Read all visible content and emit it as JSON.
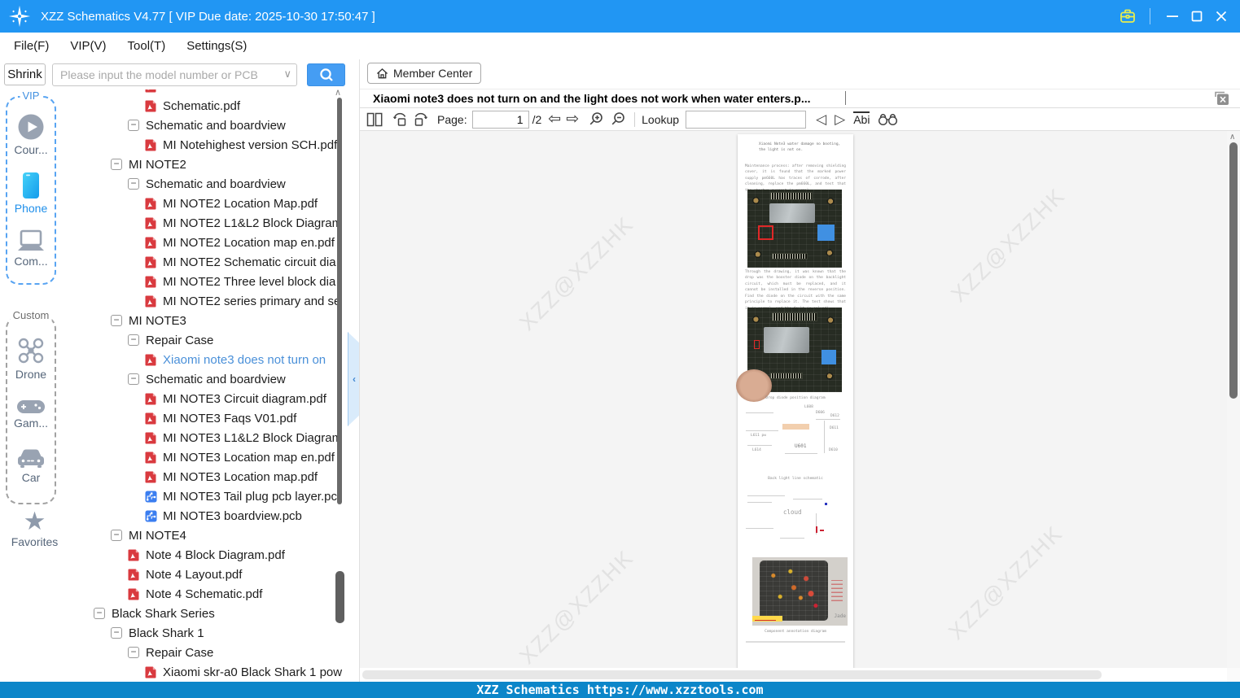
{
  "window": {
    "title": "XZZ Schematics V4.77 [ VIP Due date: 2025-10-30 17:50:47 ]"
  },
  "menu": {
    "items": [
      {
        "label": "File(F)"
      },
      {
        "label": "VIP(V)"
      },
      {
        "label": "Tool(T)"
      },
      {
        "label": "Settings(S)"
      }
    ]
  },
  "searchbar": {
    "shrink_label": "Shrink",
    "placeholder": "Please input the model number or PCB"
  },
  "member_center": {
    "label": "Member Center"
  },
  "sidebar": {
    "vip_label": "VIP",
    "custom_label": "Custom",
    "vip_items": [
      {
        "icon": "course-play-icon",
        "label": "Cour..."
      },
      {
        "icon": "phone-icon",
        "label": "Phone"
      },
      {
        "icon": "computer-icon",
        "label": "Com..."
      }
    ],
    "custom_items": [
      {
        "icon": "drone-icon",
        "label": "Drone"
      },
      {
        "icon": "gamepad-icon",
        "label": "Gam..."
      },
      {
        "icon": "car-icon",
        "label": "Car"
      }
    ],
    "favorites_label": "Favorites"
  },
  "tree": {
    "items": [
      {
        "level": 3,
        "icon": "pdf",
        "label": ""
      },
      {
        "level": 3,
        "icon": "pdf",
        "label": "Schematic.pdf"
      },
      {
        "level": 2,
        "icon": "collapse",
        "label": "Schematic and boardview"
      },
      {
        "level": 3,
        "icon": "pdf",
        "label": "MI Notehighest version SCH.pdf"
      },
      {
        "level": 1,
        "icon": "collapse",
        "label": "MI NOTE2"
      },
      {
        "level": 2,
        "icon": "collapse",
        "label": "Schematic and boardview"
      },
      {
        "level": 3,
        "icon": "pdf",
        "label": "MI NOTE2  Location Map.pdf"
      },
      {
        "level": 3,
        "icon": "pdf",
        "label": "MI NOTE2 L1&L2 Block Diagram"
      },
      {
        "level": 3,
        "icon": "pdf",
        "label": "MI NOTE2 Location map en.pdf"
      },
      {
        "level": 3,
        "icon": "pdf",
        "label": "MI NOTE2 Schematic circuit dia"
      },
      {
        "level": 3,
        "icon": "pdf",
        "label": "MI NOTE2 Three level block dia"
      },
      {
        "level": 3,
        "icon": "pdf",
        "label": "MI NOTE2 series primary and se"
      },
      {
        "level": 1,
        "icon": "collapse",
        "label": "MI NOTE3"
      },
      {
        "level": 2,
        "icon": "collapse",
        "label": "Repair Case"
      },
      {
        "level": 3,
        "icon": "pdf",
        "label": "Xiaomi note3 does not turn on",
        "selected": true
      },
      {
        "level": 2,
        "icon": "collapse",
        "label": "Schematic and boardview"
      },
      {
        "level": 3,
        "icon": "pdf",
        "label": "MI NOTE3 Circuit diagram.pdf"
      },
      {
        "level": 3,
        "icon": "pdf",
        "label": "MI NOTE3 Faqs V01.pdf"
      },
      {
        "level": 3,
        "icon": "pdf",
        "label": "MI NOTE3 L1&L2 Block Diagram"
      },
      {
        "level": 3,
        "icon": "pdf",
        "label": "MI NOTE3 Location map en.pdf"
      },
      {
        "level": 3,
        "icon": "pdf",
        "label": "MI NOTE3 Location map.pdf"
      },
      {
        "level": 3,
        "icon": "pcb",
        "label": "MI NOTE3 Tail plug pcb layer.pc"
      },
      {
        "level": 3,
        "icon": "pcb",
        "label": "MI NOTE3 boardview.pcb"
      },
      {
        "level": 1,
        "icon": "collapse",
        "label": "MI NOTE4"
      },
      {
        "level": 2,
        "icon": "pdf",
        "label": "Note 4 Block Diagram.pdf"
      },
      {
        "level": 2,
        "icon": "pdf",
        "label": "Note 4 Layout.pdf"
      },
      {
        "level": 2,
        "icon": "pdf",
        "label": "Note 4 Schematic.pdf"
      },
      {
        "level": 0,
        "icon": "collapse",
        "label": "Black Shark Series"
      },
      {
        "level": 1,
        "icon": "collapse",
        "label": "Black Shark 1"
      },
      {
        "level": 2,
        "icon": "collapse",
        "label": "Repair Case"
      },
      {
        "level": 3,
        "icon": "pdf",
        "label": "Xiaomi skr-a0 Black Shark 1 pow"
      }
    ]
  },
  "document": {
    "tab_title": "Xiaomi note3 does not turn on and the light does not work when water enters.p...",
    "toolbar": {
      "page_label": "Page:",
      "page_value": "1",
      "page_total": "/2",
      "lookup_label": "Lookup",
      "lookup_value": "",
      "abi_label": "Abi"
    }
  },
  "viewer": {
    "watermark": "XZZ@XZZHK",
    "page": {
      "title": "Xiaomi Note3 water damage no booting, the light is not on.",
      "para1": "Maintenance process: after removing shielding cover, it is found that the marked power supply pm660L has traces of corrode, after cleaning, replace the pm660L, and test that the startup current is normal.",
      "para2": "Through the drawing, it was known that the drop was the booster diode on the backlight circuit, which must be replaced, and it cannot be installed in the reverse position. Find the diode on the circuit with the same principle to replace it. The test shows that it is normal, and the fault is solved!",
      "caption1": "Drop diode position diagram",
      "caption2": "Back light line schematic",
      "caption3": "Component annotation diagram",
      "schematic_labels": [
        "L608",
        "D606",
        "D612",
        "D611",
        "L611 pw",
        "L614",
        "U601",
        "D610"
      ],
      "cloud_label": "cloud",
      "jade_label": "Jade"
    }
  },
  "statusbar": {
    "text": "XZZ Schematics https://www.xzztools.com"
  },
  "icons": {
    "minus": "−",
    "dropdown": "∨",
    "collapse_left": "‹",
    "scroll_up": "∧",
    "page_prev": "⇦",
    "page_next": "⇨",
    "find_prev": "◁",
    "find_next": "▷"
  },
  "colors": {
    "titlebar": "#2196f3",
    "search_button": "#459df3",
    "status_bar": "#0c86c9",
    "selected_tree_item": "#4a90d9",
    "vip_border": "#58a4f2",
    "watermark": "#e2e2e2"
  }
}
